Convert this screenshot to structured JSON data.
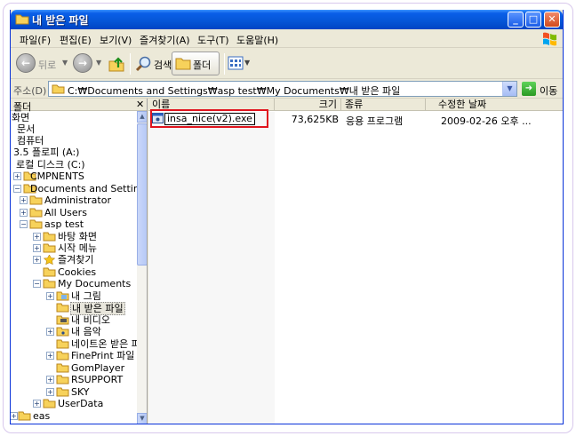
{
  "window": {
    "title": "내 받은 파일",
    "controls": {
      "minimize": "_",
      "maximize": "□",
      "close": "✕"
    }
  },
  "menu": [
    "파일(F)",
    "편집(E)",
    "보기(V)",
    "즐겨찾기(A)",
    "도구(T)",
    "도움말(H)"
  ],
  "toolbar": {
    "back_label": "뒤로",
    "search_label": "검색",
    "folders_label": "폴더"
  },
  "address": {
    "label": "주소(D)",
    "path": "C:₩Documents and Settings₩asp test₩My Documents₩내 받은 파일",
    "go_label": "이동"
  },
  "tree": {
    "header": "폴더",
    "close": "✕",
    "items": [
      {
        "label": "화면"
      },
      {
        "label": "문서"
      },
      {
        "label": "컴퓨터"
      },
      {
        "label": "3.5 플로피 (A:)"
      },
      {
        "label": "로컬 디스크 (C:)"
      },
      {
        "label": "CMPNENTS"
      },
      {
        "label": "Documents and Settings"
      },
      {
        "label": "Administrator"
      },
      {
        "label": "All Users"
      },
      {
        "label": "asp test"
      },
      {
        "label": "바탕 화면"
      },
      {
        "label": "시작 메뉴"
      },
      {
        "label": "즐겨찾기"
      },
      {
        "label": "Cookies"
      },
      {
        "label": "My Documents"
      },
      {
        "label": "내 그림"
      },
      {
        "label": "내 받은 파일"
      },
      {
        "label": "내 비디오"
      },
      {
        "label": "내 음악"
      },
      {
        "label": "네이트온 받은 파"
      },
      {
        "label": "FinePrint 파일"
      },
      {
        "label": "GomPlayer"
      },
      {
        "label": "RSUPPORT"
      },
      {
        "label": "SKY"
      },
      {
        "label": "UserData"
      },
      {
        "label": "eas"
      }
    ]
  },
  "list": {
    "columns": [
      "이름",
      "크기",
      "종류",
      "수정한 날짜"
    ],
    "rows": [
      {
        "name": "insa_nice(v2).exe",
        "size": "73,625KB",
        "type": "응용 프로그램",
        "modified": "2009-02-26 오후 ..."
      }
    ]
  },
  "colors": {
    "highlight": "#e0141e",
    "titlebar": "#0555d6"
  }
}
